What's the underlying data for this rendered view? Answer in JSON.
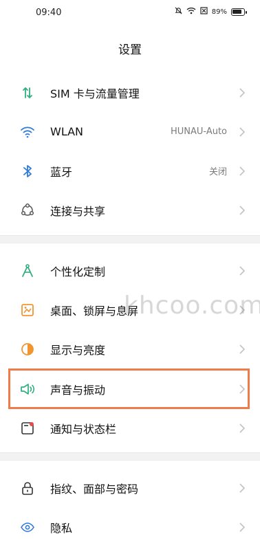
{
  "status_bar": {
    "time": "09:40",
    "battery_percent": "89%",
    "battery_level": 0.89
  },
  "header": {
    "title": "设置"
  },
  "sections": [
    {
      "items": [
        {
          "label": "SIM 卡与流量管理",
          "value": "",
          "icon": "sim-data-icon"
        },
        {
          "label": "WLAN",
          "value": "HUNAU-Auto",
          "icon": "wifi-icon"
        },
        {
          "label": "蓝牙",
          "value": "关闭",
          "icon": "bluetooth-icon"
        },
        {
          "label": "连接与共享",
          "value": "",
          "icon": "connection-share-icon"
        }
      ]
    },
    {
      "items": [
        {
          "label": "个性化定制",
          "value": "",
          "icon": "personalization-icon"
        },
        {
          "label": "桌面、锁屏与息屏",
          "value": "",
          "icon": "home-lock-screen-icon"
        },
        {
          "label": "显示与亮度",
          "value": "",
          "icon": "display-brightness-icon"
        },
        {
          "label": "声音与振动",
          "value": "",
          "icon": "sound-vibration-icon"
        },
        {
          "label": "通知与状态栏",
          "value": "",
          "icon": "notification-status-bar-icon"
        }
      ]
    },
    {
      "items": [
        {
          "label": "指纹、面部与密码",
          "value": "",
          "icon": "lock-icon"
        },
        {
          "label": "隐私",
          "value": "",
          "icon": "privacy-icon"
        }
      ]
    }
  ],
  "watermark": "khcoo.com",
  "colors": {
    "highlight": "#f07b4a",
    "accent_green": "#2fae7e",
    "accent_blue": "#2f7bd8"
  }
}
